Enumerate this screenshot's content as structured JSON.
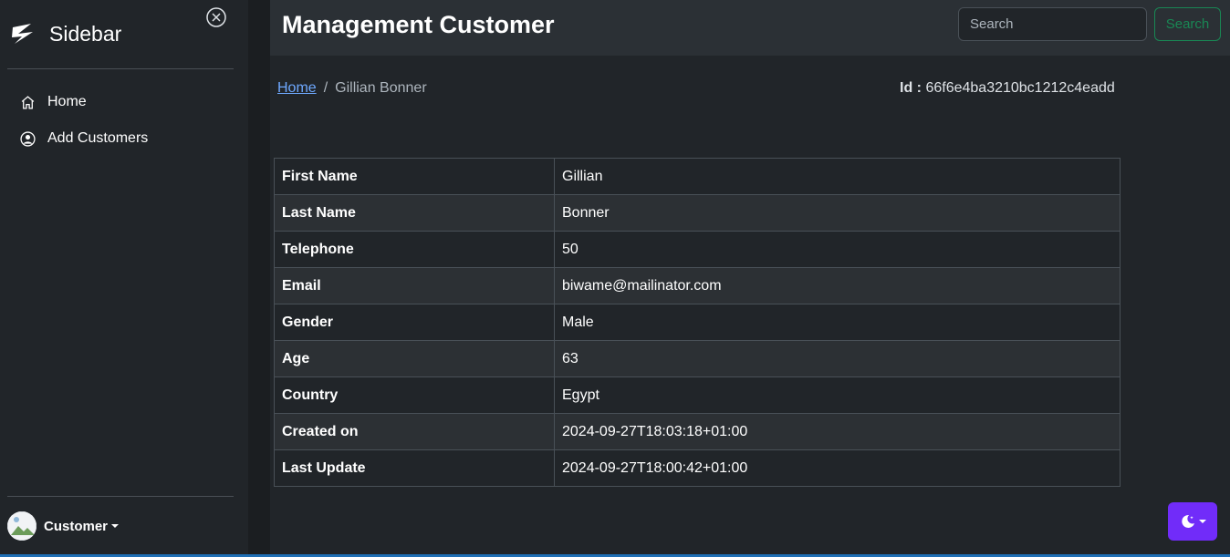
{
  "sidebar": {
    "brand": "Sidebar",
    "items": [
      {
        "label": "Home",
        "icon": "house-icon"
      },
      {
        "label": "Add Customers",
        "icon": "person-circle-icon"
      }
    ],
    "user": {
      "label": "Customer"
    }
  },
  "header": {
    "title": "Management Customer",
    "search_placeholder": "Search",
    "search_button": "Search"
  },
  "breadcrumb": {
    "home": "Home",
    "separator": "/",
    "current": "Gillian Bonner"
  },
  "record": {
    "id_label": "Id :",
    "id_value": "66f6e4ba3210bc1212c4eadd"
  },
  "details": [
    {
      "key": "First Name",
      "value": "Gillian"
    },
    {
      "key": "Last Name",
      "value": "Bonner"
    },
    {
      "key": "Telephone",
      "value": "50"
    },
    {
      "key": "Email",
      "value": "biwame@mailinator.com"
    },
    {
      "key": "Gender",
      "value": "Male"
    },
    {
      "key": "Age",
      "value": "63"
    },
    {
      "key": "Country",
      "value": "Egypt"
    },
    {
      "key": "Created on",
      "value": "2024-09-27T18:03:18+01:00"
    },
    {
      "key": "Last Update",
      "value": "2024-09-27T18:00:42+01:00"
    }
  ],
  "colors": {
    "background": "#212529",
    "header": "#2b3035",
    "accent_success": "#198754",
    "theme_button": "#712cf9",
    "link": "#6ea8fe"
  }
}
